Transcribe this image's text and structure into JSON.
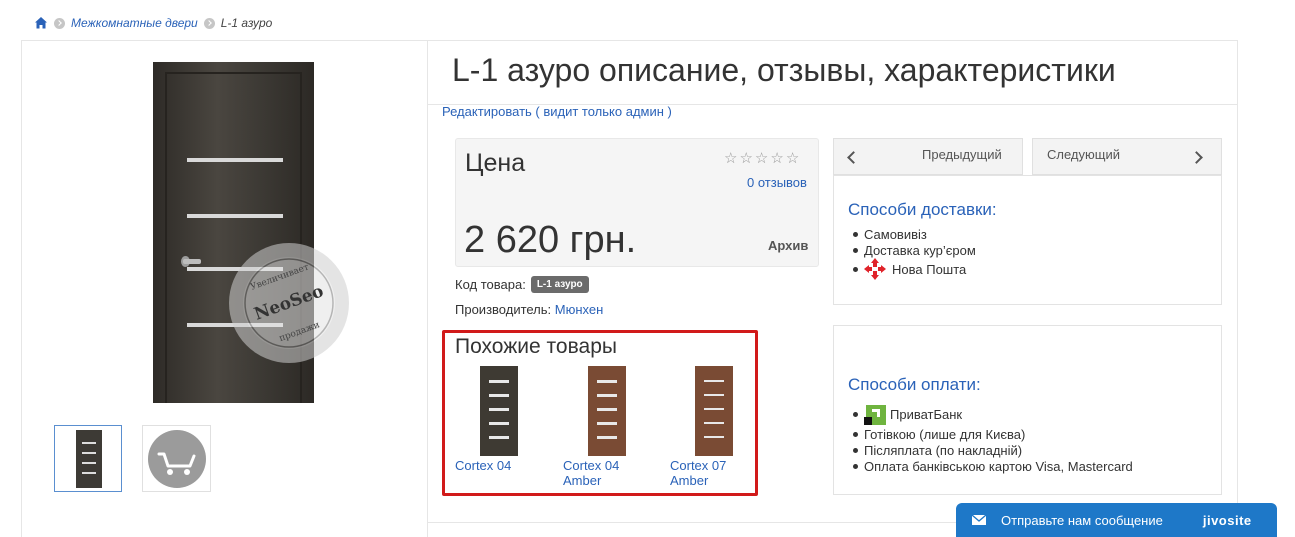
{
  "breadcrumb": {
    "home_icon": "home-icon",
    "category": "Межкомнатные двери",
    "current": "L-1 азуро"
  },
  "product": {
    "title": "L-1 азуро описание, отзывы, характеристики",
    "edit_link": "Редактировать ( видит только админ )",
    "price_label": "Цена",
    "rating_stars": 0,
    "reviews": "0 отзывов",
    "price": "2 620 грн.",
    "status": "Архив",
    "sku_label": "Код товара:",
    "sku": "L-1 азуро",
    "maker_label": "Производитель:",
    "maker": "Мюнхен"
  },
  "watermark": {
    "lines": [
      "Увеличивает",
      "NeoSeo",
      "продажи"
    ]
  },
  "similar": {
    "title": "Похожие товары",
    "items": [
      {
        "name": "Cortex 04",
        "color": "#3e3a33"
      },
      {
        "name": "Cortex 04 Amber",
        "color": "#7a4b34"
      },
      {
        "name": "Cortex 07 Amber",
        "color": "#7a4b34"
      }
    ]
  },
  "nav": {
    "prev": "Предыдущий",
    "next": "Следующий"
  },
  "delivery": {
    "title": "Способи доставки:",
    "items": [
      "Самовивіз",
      "Доставка кур’єром",
      "Нова Пошта"
    ]
  },
  "payment": {
    "title": "Способи оплати:",
    "items": [
      "ПриватБанк",
      "Готівкою (лише для Києва)",
      "Післяплата (по накладній)",
      "Оплата банківською картою Visa, Mastercard"
    ]
  },
  "chat": {
    "text": "Отправьте нам сообщение",
    "brand": "jivosite"
  },
  "colors": {
    "link": "#2a62b8",
    "highlight": "#d11a1a",
    "chat": "#1e78c8"
  }
}
